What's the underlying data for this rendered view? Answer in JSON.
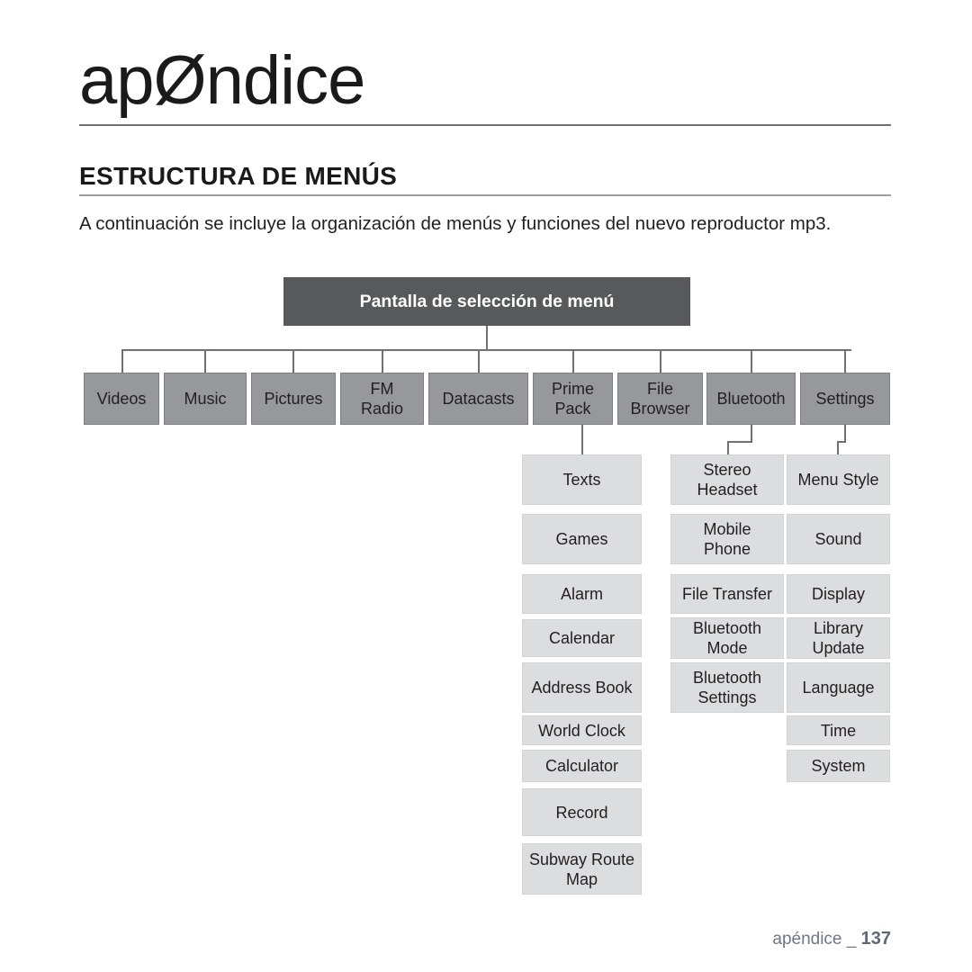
{
  "header": {
    "title": "apØndice",
    "section_title": "ESTRUCTURA DE MENÚS",
    "intro": "A continuación se incluye la organización de menús y funciones del nuevo reproductor mp3."
  },
  "diagram": {
    "root": {
      "label": "Pantalla de selección de menú"
    },
    "level1": [
      {
        "label": "Videos"
      },
      {
        "label": "Music"
      },
      {
        "label": "Pictures"
      },
      {
        "label": "FM\nRadio"
      },
      {
        "label": "Datacasts"
      },
      {
        "label": "Prime\nPack"
      },
      {
        "label": "File\nBrowser"
      },
      {
        "label": "Bluetooth"
      },
      {
        "label": "Settings"
      }
    ],
    "prime_pack_children": [
      {
        "label": "Texts"
      },
      {
        "label": "Games"
      },
      {
        "label": "Alarm"
      },
      {
        "label": "Calendar"
      },
      {
        "label": "Address Book"
      },
      {
        "label": "World Clock"
      },
      {
        "label": "Calculator"
      },
      {
        "label": "Record"
      },
      {
        "label": "Subway Route\nMap"
      }
    ],
    "bluetooth_children": [
      {
        "label": "Stereo\nHeadset"
      },
      {
        "label": "Mobile\nPhone"
      },
      {
        "label": "File Transfer"
      },
      {
        "label": "Bluetooth\nMode"
      },
      {
        "label": "Bluetooth\nSettings"
      }
    ],
    "settings_children": [
      {
        "label": "Menu Style"
      },
      {
        "label": "Sound"
      },
      {
        "label": "Display"
      },
      {
        "label": "Library\nUpdate"
      },
      {
        "label": "Language"
      },
      {
        "label": "Time"
      },
      {
        "label": "System"
      }
    ]
  },
  "footer": {
    "label": "apéndice _",
    "page": "137"
  },
  "colors": {
    "root_box": "#58595b",
    "level1_box": "#96989b",
    "level2_box": "#dcdddf",
    "connector": "#6e7072",
    "footer_text": "#6d7788"
  }
}
